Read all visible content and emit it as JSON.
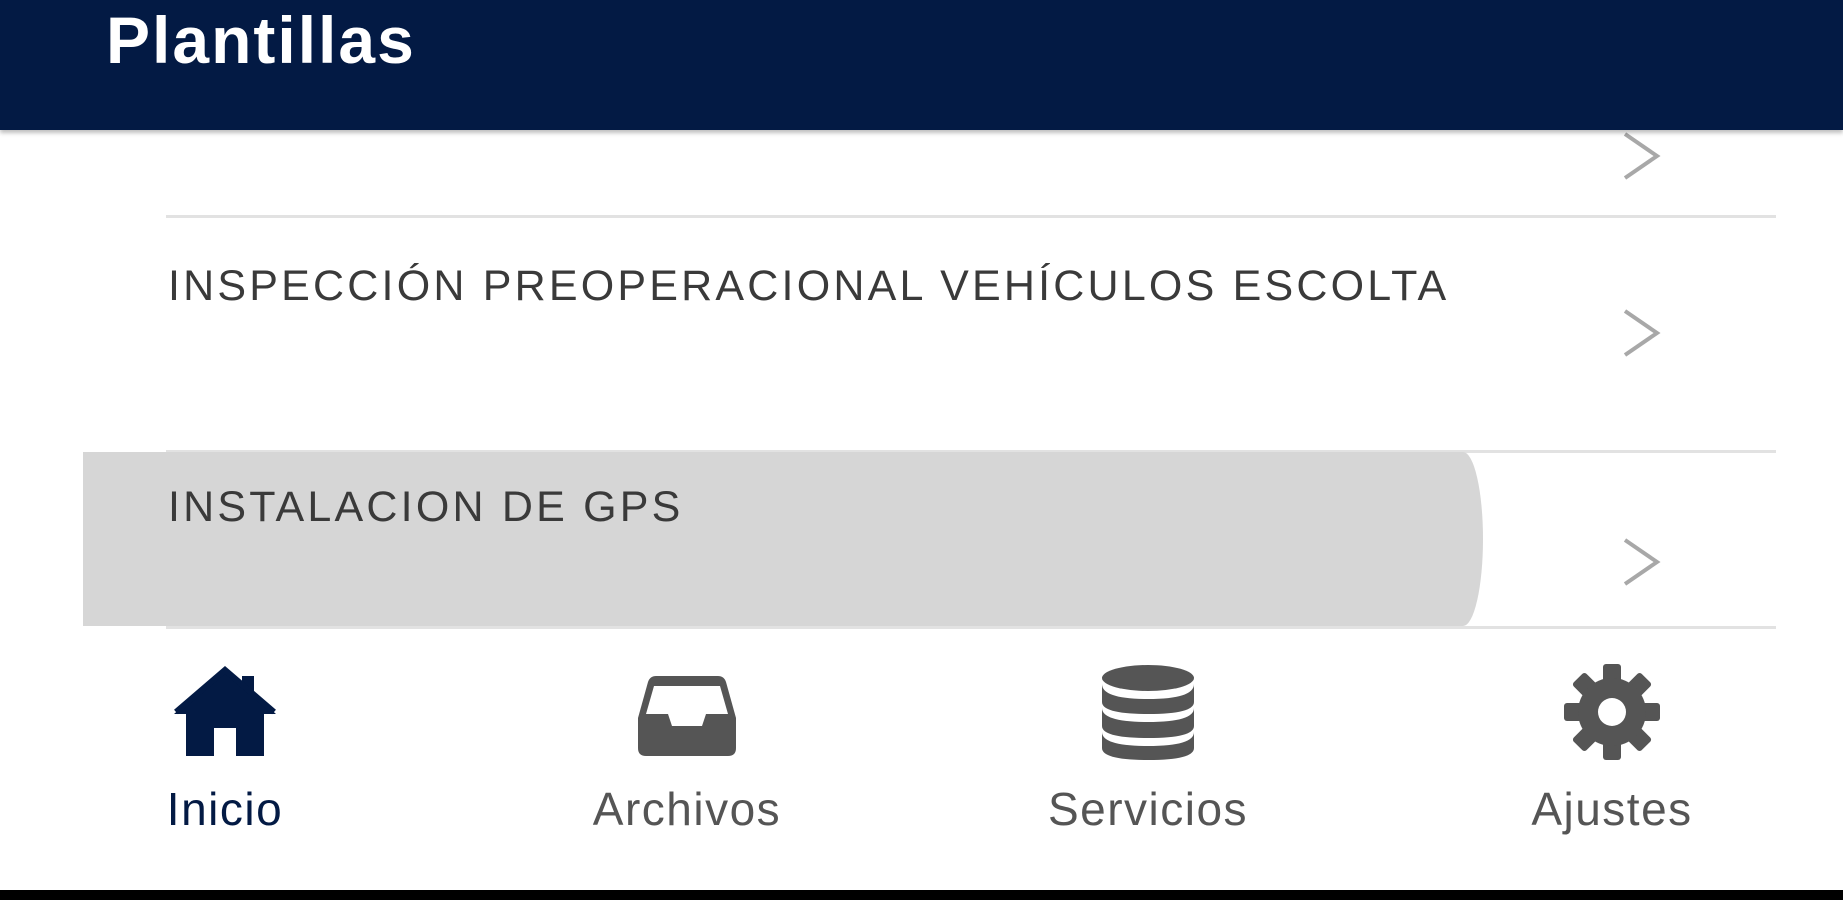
{
  "header": {
    "title": "Plantillas"
  },
  "list": {
    "items": [
      {
        "label": ""
      },
      {
        "label": "INSPECCIÓN PREOPERACIONAL VEHÍCULOS ESCOLTA"
      },
      {
        "label": "INSTALACION DE GPS",
        "pressed": true
      }
    ]
  },
  "bottom_nav": {
    "items": [
      {
        "label": "Inicio",
        "icon": "home-icon",
        "active": true
      },
      {
        "label": "Archivos",
        "icon": "inbox-icon",
        "active": false
      },
      {
        "label": "Servicios",
        "icon": "database-icon",
        "active": false
      },
      {
        "label": "Ajustes",
        "icon": "gear-icon",
        "active": false
      }
    ]
  },
  "colors": {
    "header_bg": "#031a44",
    "active_nav": "#031a44",
    "inactive_nav": "#555555",
    "pressed_row": "#d6d6d6",
    "divider": "#e2e2e2"
  }
}
